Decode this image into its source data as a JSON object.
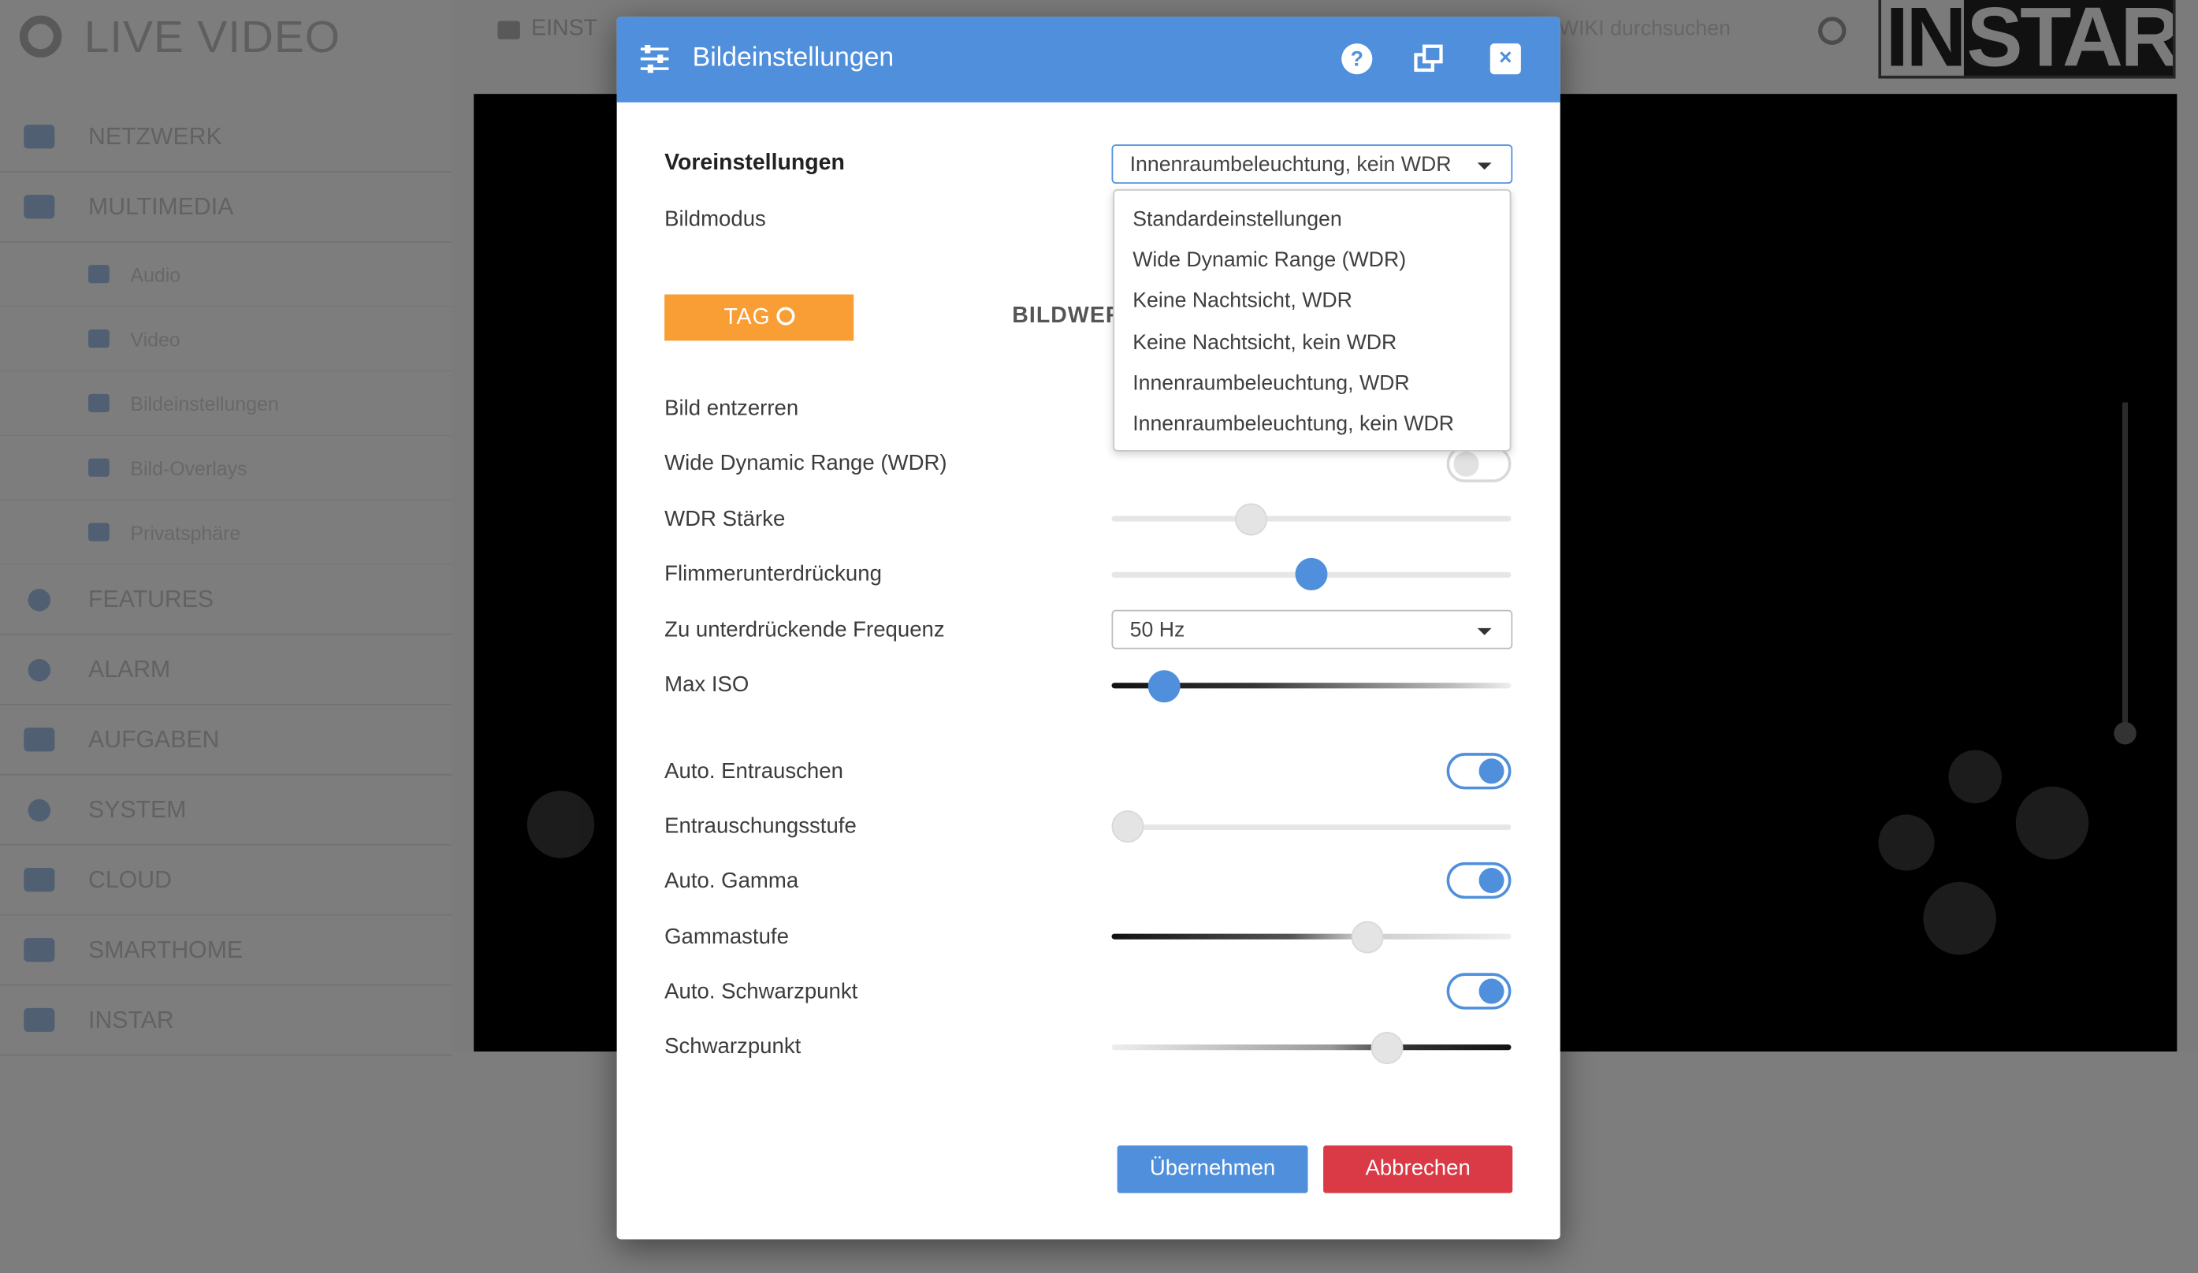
{
  "app": {
    "brand": "LIVE VIDEO",
    "nav": [
      {
        "label": "NETZWERK"
      },
      {
        "label": "MULTIMEDIA"
      },
      {
        "label": "FEATURES"
      },
      {
        "label": "ALARM"
      },
      {
        "label": "AUFGABEN"
      },
      {
        "label": "SYSTEM"
      },
      {
        "label": "CLOUD"
      },
      {
        "label": "SMARTHOME"
      },
      {
        "label": "INSTAR"
      }
    ],
    "subnav": [
      {
        "label": "Audio"
      },
      {
        "label": "Video"
      },
      {
        "label": "Bildeinstellungen"
      },
      {
        "label": "Bild-Overlays"
      },
      {
        "label": "Privatsphäre"
      }
    ],
    "topbar": {
      "tab_label": "EINST",
      "search_text": "WIKI durchsuchen",
      "logo_a": "IN",
      "logo_b": "STAR"
    }
  },
  "modal": {
    "title": "Bildeinstellungen",
    "help_label": "?",
    "close_label": "×",
    "presets_label": "Voreinstellungen",
    "presets_selected": "Innenraumbeleuchtung, kein WDR",
    "presets_options": [
      "Standardeinstellungen",
      "Wide Dynamic Range (WDR)",
      "Keine Nachtsicht, WDR",
      "Keine Nachtsicht, kein WDR",
      "Innenraumbeleuchtung, WDR",
      "Innenraumbeleuchtung, kein WDR"
    ],
    "bildmodus_label": "Bildmodus",
    "tab_day": "TAG",
    "tab_bildwert": "BILDWERTE",
    "rows": {
      "bild_entzerren": "Bild entzerren",
      "wdr": "Wide Dynamic Range (WDR)",
      "wdr_staerke": "WDR Stärke",
      "flimmer": "Flimmerunterdrückung",
      "frequenz": "Zu unterdrückende Frequenz",
      "frequenz_value": "50 Hz",
      "max_iso": "Max ISO",
      "auto_entrauschen": "Auto. Entrauschen",
      "entrauschungsstufe": "Entrauschungsstufe",
      "auto_gamma": "Auto. Gamma",
      "gammastufe": "Gammastufe",
      "auto_schwarzpunkt": "Auto. Schwarzpunkt",
      "schwarzpunkt": "Schwarzpunkt"
    },
    "values": {
      "wdr_enabled": false,
      "wdr_staerke": 0.35,
      "flimmer": 0.5,
      "max_iso": 0.13,
      "auto_entrauschen": true,
      "entrauschungsstufe": 0.04,
      "auto_gamma": true,
      "gammastufe": 0.64,
      "auto_schwarzpunkt": true,
      "schwarzpunkt": 0.69
    },
    "apply_label": "Übernehmen",
    "cancel_label": "Abbrechen"
  },
  "colors": {
    "accent": "#4f8fdc",
    "day_tab": "#f99d35",
    "cancel": "#d93a45"
  }
}
